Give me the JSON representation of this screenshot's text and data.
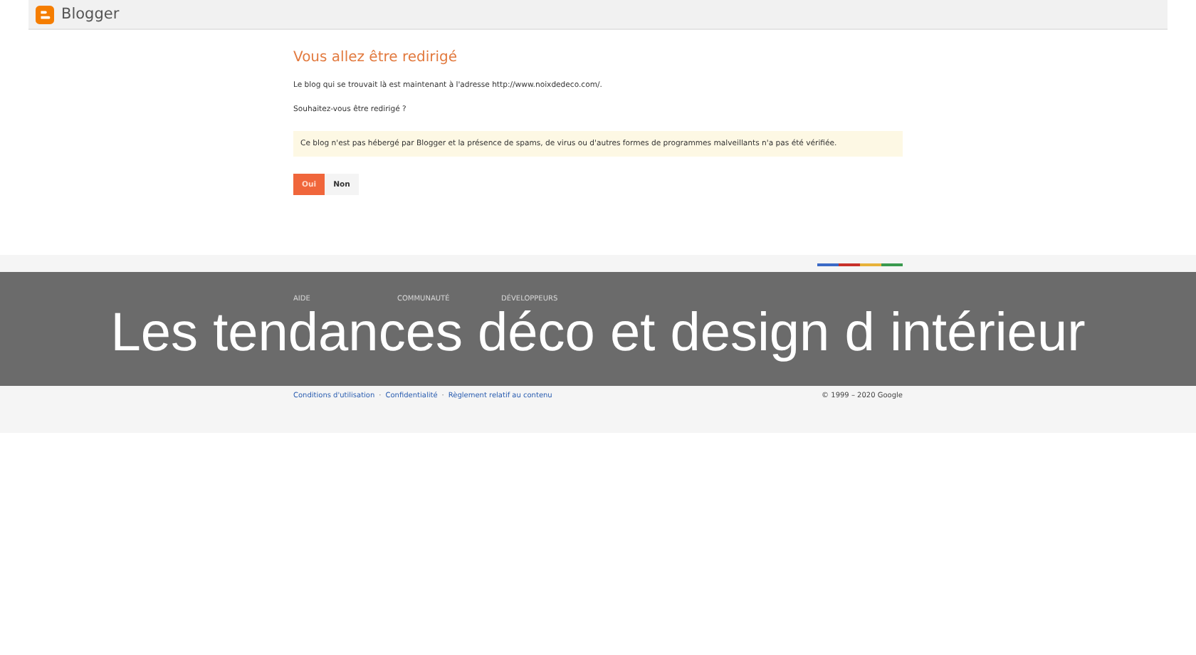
{
  "header": {
    "brand": "Blogger"
  },
  "main": {
    "title": "Vous allez être redirigé",
    "message": "Le blog qui se trouvait là est maintenant à l'adresse http://www.noixdedeco.com/.",
    "question": "Souhaitez-vous être redirigé ?",
    "warning": "Ce blog n'est pas hébergé par Blogger et la présence de spams, de virus ou d'autres formes de programmes malveillants n'a pas été vérifiée.",
    "buttons": [
      {
        "label": "Oui",
        "kind": "primary"
      },
      {
        "label": "Non",
        "kind": "secondary"
      }
    ]
  },
  "footer": {
    "headings": [
      "AIDE",
      "COMMUNAUTÉ",
      "DÉVELOPPEURS"
    ],
    "links": [
      "Conditions d'utilisation",
      "Confidentialité",
      "Règlement relatif au contenu"
    ],
    "separator": "·",
    "copyright": "© 1999 – 2020 Google"
  },
  "caption": "Les tendances déco et design d intérieur"
}
